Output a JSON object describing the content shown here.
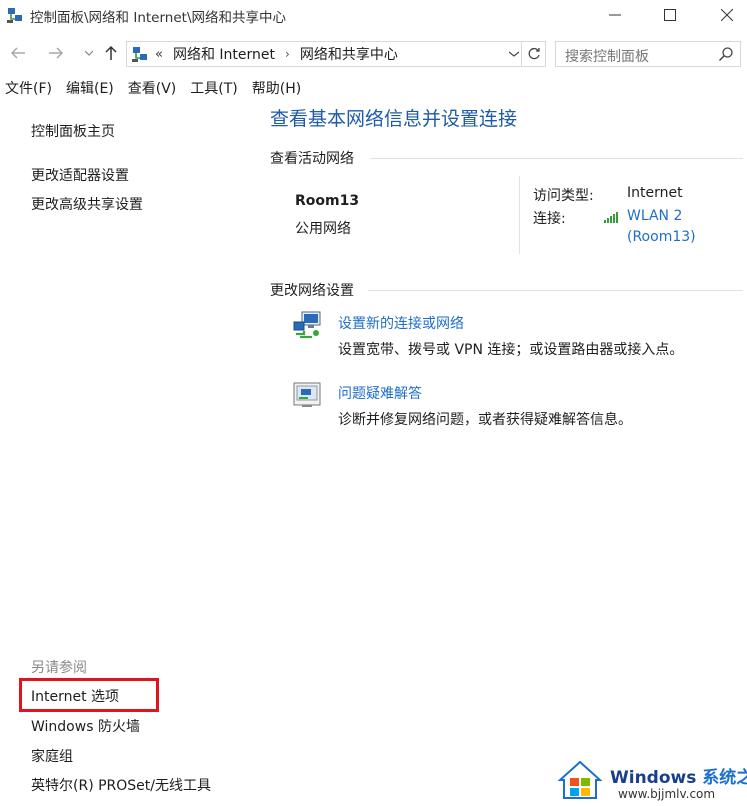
{
  "window": {
    "title": "控制面板\\网络和 Internet\\网络和共享中心"
  },
  "address_bar": {
    "prefix": "«",
    "crumbs": [
      "网络和 Internet",
      "网络和共享中心"
    ],
    "separator": "›"
  },
  "search": {
    "placeholder": "搜索控制面板"
  },
  "menu": {
    "items": [
      "文件(F)",
      "编辑(E)",
      "查看(V)",
      "工具(T)",
      "帮助(H)"
    ]
  },
  "left_nav": {
    "top_links": [
      "控制面板主页",
      "更改适配器设置",
      "更改高级共享设置"
    ],
    "see_also_title": "另请参阅",
    "see_also_links": [
      "Internet 选项",
      "Windows 防火墙",
      "家庭组",
      "英特尔(R) PROSet/无线工具"
    ]
  },
  "main": {
    "heading": "查看基本网络信息并设置连接",
    "active_networks_title": "查看活动网络",
    "network": {
      "name": "Room13",
      "type": "公用网络",
      "access_type_label": "访问类型:",
      "access_type_value": "Internet",
      "connection_label": "连接:",
      "connection_value_line1": "WLAN 2",
      "connection_value_line2": "(Room13)"
    },
    "change_settings_title": "更改网络设置",
    "tasks": [
      {
        "link": "设置新的连接或网络",
        "description": "设置宽带、拨号或 VPN 连接；或设置路由器或接入点。",
        "icon": "network-setup-icon"
      },
      {
        "link": "问题疑难解答",
        "description": "诊断并修复网络问题，或者获得疑难解答信息。",
        "icon": "troubleshoot-icon"
      }
    ]
  },
  "watermark": {
    "brand": "Windows",
    "brand_cn": "系统之家",
    "url": "www.bjjmlv.com"
  },
  "colors": {
    "heading_blue": "#1e5ba8",
    "link_blue": "#1e6ec8",
    "highlight_red": "#e0141e"
  }
}
